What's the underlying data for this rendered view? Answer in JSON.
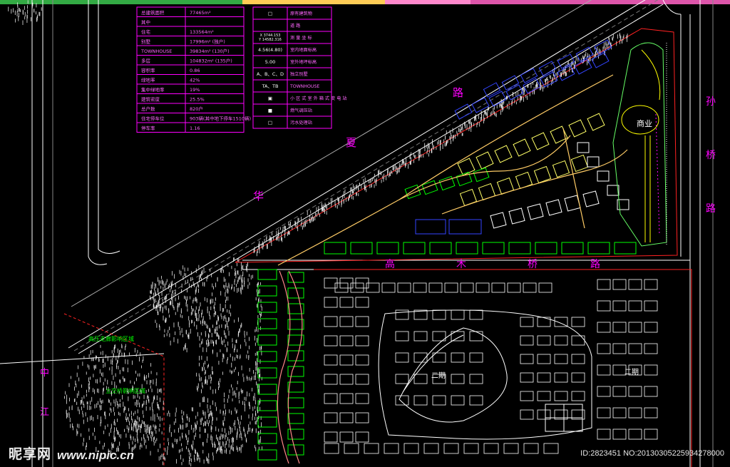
{
  "legend_table": {
    "rows": [
      {
        "label": "总建筑面积",
        "value": "77465m²"
      },
      {
        "label": "其中",
        "value": ""
      },
      {
        "label": "住宅",
        "value": "133564m²"
      },
      {
        "label": "别墅",
        "value": "17996m²  (独户)"
      },
      {
        "label": "TOWNHOUSE",
        "value": "39834m²  (130户)"
      },
      {
        "label": "多层",
        "value": "104832m²  (135户)"
      },
      {
        "label": "容积率",
        "value": "0.86"
      },
      {
        "label": "绿地率",
        "value": "42%"
      },
      {
        "label": "集中绿地率",
        "value": "19%"
      },
      {
        "label": "建筑密度",
        "value": "25.5%"
      },
      {
        "label": "总户数",
        "value": "820户"
      },
      {
        "label": "住宅停车位",
        "value": "903辆(其中地下停车1510辆)"
      },
      {
        "label": "停车率",
        "value": "1.16"
      }
    ]
  },
  "symbol_legend": {
    "items": [
      {
        "sym": "□",
        "label": "原有建筑物"
      },
      {
        "sym": "",
        "label": "道  路"
      },
      {
        "sym": "X 3744.153\nY 14582.316",
        "label": "测 量 坐 标"
      },
      {
        "sym": "4.56(4.80)",
        "label": "室内地面标高"
      },
      {
        "sym": "5.00",
        "label": "室外地坪标高"
      },
      {
        "sym": "A、B、C、D",
        "label": "独立别墅"
      },
      {
        "sym": "TA、TB",
        "label": "TOWNHOUSE"
      },
      {
        "sym": "▣",
        "label": "小 区 式 室 外 箱 式 变 电 站"
      },
      {
        "sym": "■",
        "label": "燃气调压站"
      },
      {
        "sym": "□",
        "label": "污水处理站"
      }
    ]
  },
  "map_labels": {
    "road_north_1": "华",
    "road_north_2": "夏",
    "road_north_3": "路",
    "road_east_1": "孙",
    "road_east_2": "桥",
    "road_east_3": "路",
    "road_south_1": "高",
    "road_south_2": "木",
    "road_south_3": "桥",
    "road_south_4": "路",
    "road_west_1": "中",
    "road_west_2": "江",
    "zone_1": "商业",
    "zone_2": "二期",
    "zone_3": "二期",
    "area_note_1": "高压走廊影响区域",
    "area_note_2": "立交桥影响区域"
  },
  "watermark": {
    "logo": "昵享网",
    "url": "www.nipic.cn",
    "id_text": "ID:2823451 NO:20130305225934278000"
  },
  "colors": {
    "background": "#000000",
    "table_line": "#ff00ff",
    "road_line": "#ffffff",
    "boundary": "#ff0000",
    "building_green": "#00ff00",
    "building_blue": "#0000ff",
    "building_yellow": "#ffff00",
    "text_magenta": "#ff00ff",
    "text_green": "#00ff00",
    "tree_white": "#ffffff"
  }
}
